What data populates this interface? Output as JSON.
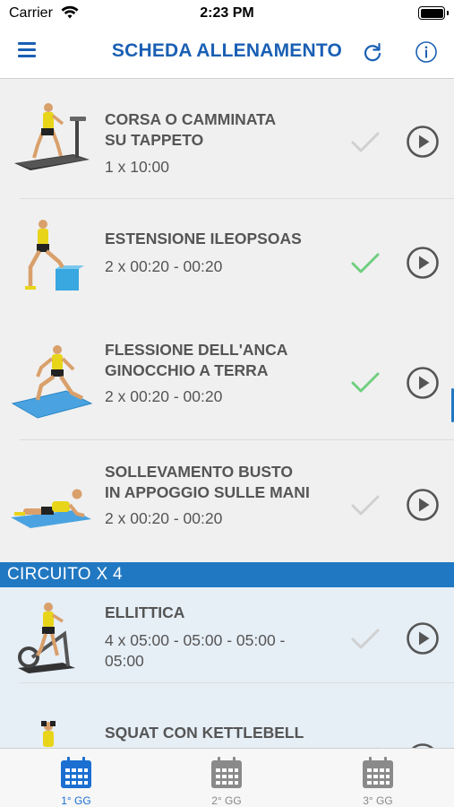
{
  "status_bar": {
    "carrier": "Carrier",
    "time": "2:23 PM"
  },
  "nav": {
    "title": "SCHEDA ALLENAMENTO",
    "menu_icon": "hamburger-icon",
    "refresh_icon": "refresh-icon",
    "info_icon": "info-icon"
  },
  "exercises": [
    {
      "name_line1": "CORSA O CAMMINATA",
      "name_line2": "SU TAPPETO",
      "sets": "1 x 10:00",
      "completed": false
    },
    {
      "name_line1": "ESTENSIONE ILEOPSOAS",
      "name_line2": "",
      "sets": "2 x 00:20 - 00:20",
      "completed": true
    },
    {
      "name_line1": "FLESSIONE DELL'ANCA",
      "name_line2": "GINOCCHIO A TERRA",
      "sets": "2 x 00:20 - 00:20",
      "completed": true
    },
    {
      "name_line1": "SOLLEVAMENTO BUSTO",
      "name_line2": "IN APPOGGIO SULLE MANI",
      "sets": "2 x 00:20 - 00:20",
      "completed": false
    }
  ],
  "circuit": {
    "title": "CIRCUITO X 4",
    "exercises": [
      {
        "name_line1": "ELLITTICA",
        "sets_line1": "4 x 05:00 - 05:00 - 05:00 -",
        "sets_line2": "05:00",
        "completed": false
      },
      {
        "name_line1": "SQUAT CON KETTLEBELL",
        "completed": false
      }
    ]
  },
  "tabs": [
    {
      "label": "1° GG",
      "active": true
    },
    {
      "label": "2° GG",
      "active": false
    },
    {
      "label": "3° GG",
      "active": false
    }
  ],
  "colors": {
    "accent": "#1a5fb4",
    "circuit": "#2178c2",
    "check_done": "#6fcf7f",
    "check_pending": "#d0d0d0"
  }
}
